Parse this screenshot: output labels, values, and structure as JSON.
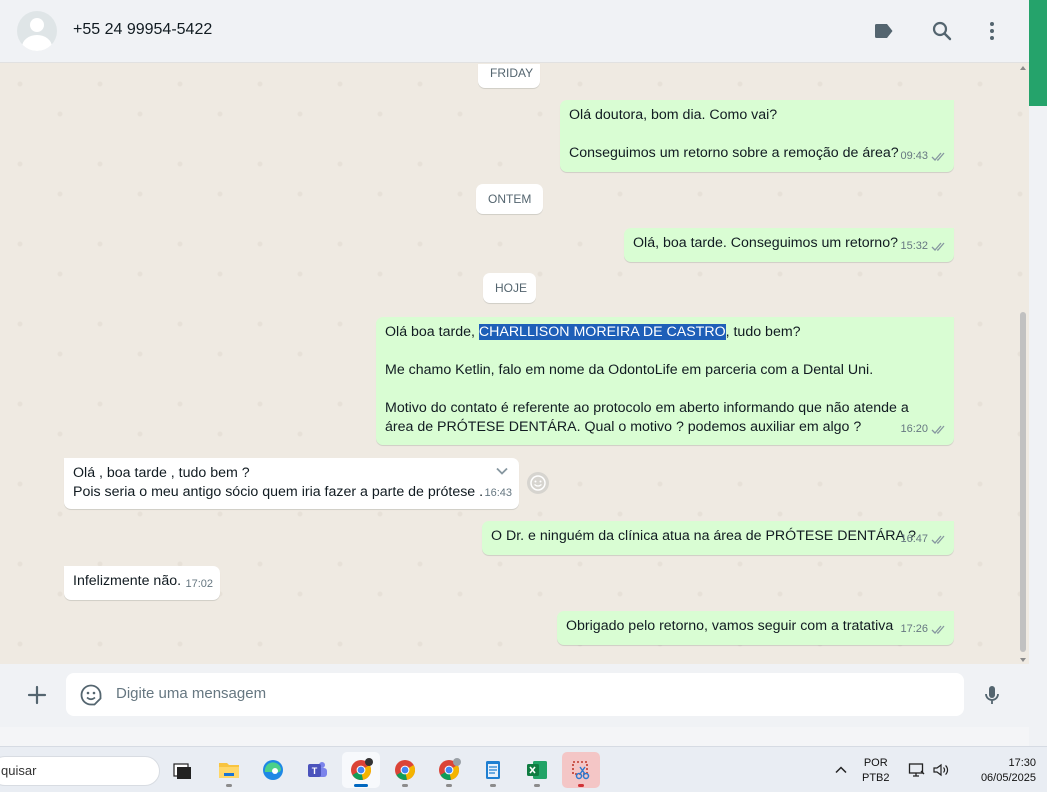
{
  "header": {
    "contact_name": "+55 24 99954-5422",
    "icons": [
      "label-icon",
      "search-icon",
      "menu-icon"
    ]
  },
  "chat": {
    "days": {
      "friday": "FRIDAY",
      "ontem": "ONTEM",
      "hoje": "HOJE"
    },
    "messages": [
      {
        "dir": "out",
        "lines": [
          "Olá doutora, bom dia. Como vai?",
          "",
          "Conseguimos um retorno sobre a remoção de área?"
        ],
        "time": "09:43",
        "status": "read"
      },
      {
        "dir": "out",
        "lines": [
          "Olá, boa tarde. Conseguimos um retorno?"
        ],
        "time": "15:32",
        "status": "read"
      },
      {
        "dir": "out",
        "pre_highlight": "Olá boa tarde, ",
        "highlight": "CHARLLISON MOREIRA DE CASTRO",
        "post_highlight": ", tudo bem?",
        "lines": [
          "",
          "Me chamo Ketlin, falo em nome da OdontoLife em parceria com a Dental Uni.",
          "",
          "Motivo do contato é referente ao protocolo em aberto informando que não atende a",
          "área de PRÓTESE DENTÁRA. Qual o motivo ? podemos auxiliar em algo ?"
        ],
        "time": "16:20",
        "status": "read"
      },
      {
        "dir": "in",
        "lines": [
          "Olá , boa tarde , tudo bem ?",
          "Pois seria o meu antigo sócio quem iria fazer a parte de prótese ."
        ],
        "time": "16:43"
      },
      {
        "dir": "out",
        "lines": [
          "O Dr.  e ninguém da clínica atua na área de PRÓTESE DENTÁRA ?"
        ],
        "time": "16:47",
        "status": "read"
      },
      {
        "dir": "in",
        "lines": [
          "Infelizmente não."
        ],
        "time": "17:02"
      },
      {
        "dir": "out",
        "lines": [
          "Obrigado pelo retorno, vamos seguir com a tratativa"
        ],
        "time": "17:26",
        "status": "read"
      }
    ]
  },
  "composer": {
    "placeholder": "Digite uma mensagem"
  },
  "taskbar": {
    "search_text": "quisar",
    "apps": [
      "task-view",
      "file-explorer",
      "edge",
      "teams",
      "chrome",
      "chrome",
      "chrome",
      "notepad",
      "excel",
      "snipping-tool"
    ],
    "lang_line1": "POR",
    "lang_line2": "PTB2",
    "time": "17:30",
    "date": "06/05/2025"
  },
  "colors": {
    "outgoing_bubble": "#d9fdd3",
    "incoming_bubble": "#ffffff",
    "chat_bg": "#efeae2",
    "header_bg": "#f0f2f5",
    "read_ticks": "#667781",
    "selection": "#1e5fb8"
  }
}
